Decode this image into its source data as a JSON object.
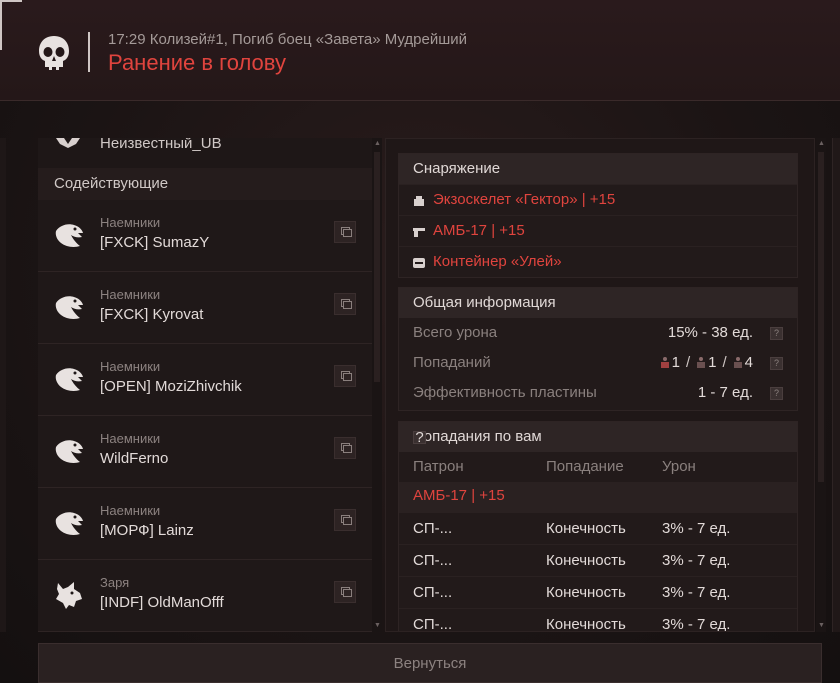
{
  "header": {
    "time_line": "17:29 Колизей#1, Погиб боец «Завета» Мудрейший",
    "title": "Ранение в голову"
  },
  "left_panel": {
    "unknown_player": "Неизвестный_UB",
    "section_title": "Содействующие",
    "players": [
      {
        "faction": "Наемники",
        "name": "[FXCK] SumazY",
        "icon": "eagle-icon"
      },
      {
        "faction": "Наемники",
        "name": "[FXCK] Kyrovat",
        "icon": "eagle-icon"
      },
      {
        "faction": "Наемники",
        "name": "[OPEN] MoziZhivchik",
        "icon": "eagle-icon"
      },
      {
        "faction": "Наемники",
        "name": "WildFerno",
        "icon": "eagle-icon"
      },
      {
        "faction": "Наемники",
        "name": "[МОРФ] Lainz",
        "icon": "eagle-icon"
      },
      {
        "faction": "Заря",
        "name": "[INDF] OldManOfff",
        "icon": "wolf-icon"
      }
    ]
  },
  "equipment": {
    "title": "Снаряжение",
    "items": [
      {
        "icon": "armor-icon",
        "text": "Экзоскелет «Гектор» | +15"
      },
      {
        "icon": "pistol-icon",
        "text": "АМБ-17 | +15"
      },
      {
        "icon": "container-icon",
        "text": "Контейнер «Улей»"
      }
    ]
  },
  "general_info": {
    "title": "Общая информация",
    "total_damage_label": "Всего урона",
    "total_damage_value": "15% - 38 ед.",
    "hits_label": "Попаданий",
    "hits_values": [
      "1",
      "1",
      "4"
    ],
    "plate_label": "Эффективность пластины",
    "plate_value": "1 - 7 ед."
  },
  "hits_on_you": {
    "title": "Попадания по вам",
    "columns": [
      "Патрон",
      "Попадание",
      "Урон"
    ],
    "weapon": "АМБ-17 | +15",
    "rows": [
      {
        "ammo": "СП-...",
        "part": "Конечность",
        "damage": "3% - 7 ед."
      },
      {
        "ammo": "СП-...",
        "part": "Конечность",
        "damage": "3% - 7 ед."
      },
      {
        "ammo": "СП-...",
        "part": "Конечность",
        "damage": "3% - 7 ед."
      },
      {
        "ammo": "СП-...",
        "part": "Конечность",
        "damage": "3% - 7 ед."
      }
    ]
  },
  "footer": {
    "back_label": "Вернуться"
  },
  "colors": {
    "accent": "#e0443e",
    "background": "#1b1414"
  }
}
